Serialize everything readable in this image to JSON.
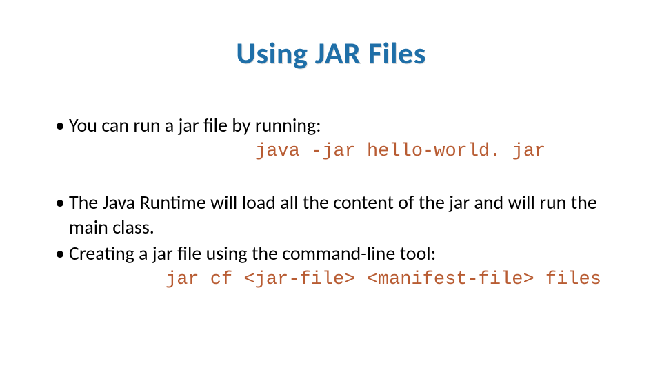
{
  "title": "Using JAR Files",
  "bullets": {
    "b1": "You can run a jar file by running:",
    "code1": "java -jar hello-world. jar",
    "b2": "The Java Runtime will load all the content of the jar and will run the main class.",
    "b3": "Creating a jar file using the command-line tool:",
    "code2": "jar cf <jar-file> <manifest-file> files"
  }
}
